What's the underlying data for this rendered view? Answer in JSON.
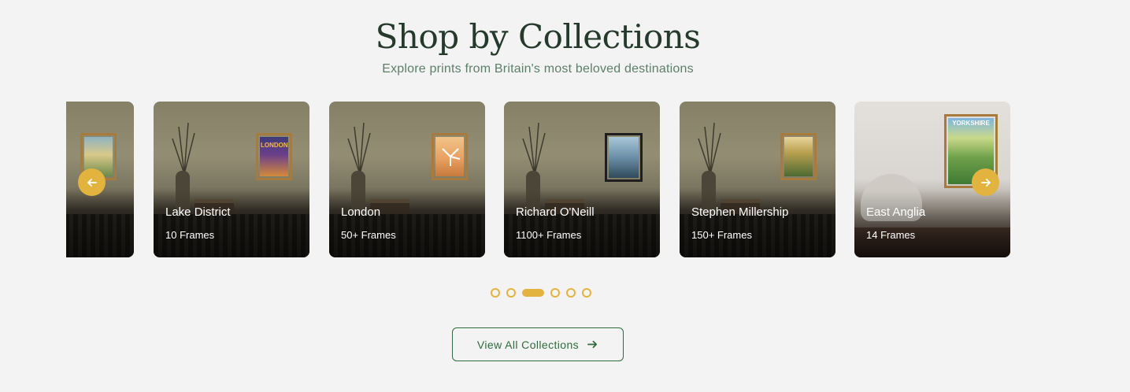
{
  "section": {
    "title": "Shop by Collections",
    "subtitle": "Explore prints from Britain's most beloved destinations"
  },
  "collections": [
    {
      "name": "",
      "count": "",
      "poster": "viaduct-poster"
    },
    {
      "name": "Lake District",
      "count": "10 Frames",
      "poster": "london-poster"
    },
    {
      "name": "London",
      "count": "50+ Frames",
      "poster": "windmill-poster"
    },
    {
      "name": "Richard O'Neill",
      "count": "1100+ Frames",
      "poster": "viaduct-poster"
    },
    {
      "name": "Stephen Millership",
      "count": "150+ Frames",
      "poster": "castle-poster"
    },
    {
      "name": "East Anglia",
      "count": "14 Frames",
      "poster": "yorkshire-poster"
    }
  ],
  "posters": {
    "yorkshire_label": "YORKSHIRE",
    "london_label": "LONDON"
  },
  "carousel": {
    "prev_icon": "arrow-left-icon",
    "next_icon": "arrow-right-icon",
    "dot_count": 6,
    "active_dot": 3
  },
  "cta": {
    "label": "View All Collections",
    "icon": "arrow-right-icon"
  },
  "colors": {
    "accent": "#e2b43f",
    "heading": "#253a2c",
    "subheading": "#5d7f6a",
    "cta": "#2f6b3d"
  }
}
